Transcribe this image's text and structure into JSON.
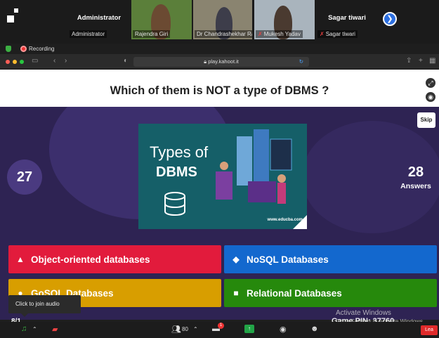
{
  "participants": [
    {
      "name": "Administrator",
      "big_name": "Administrator",
      "muted": false
    },
    {
      "name": "Rajendra Giri",
      "muted": false
    },
    {
      "name": "Dr Chandrashekhar Rag...",
      "muted": false
    },
    {
      "name": "Mukesh Yadav",
      "muted": true
    },
    {
      "name": "Sagar tiwari",
      "big_name": "Sagar tiwari",
      "muted": true
    }
  ],
  "recording": {
    "label": "Recording"
  },
  "browser": {
    "url": "play.kahoot.it"
  },
  "quiz": {
    "question": "Which of them is NOT a type of DBMS ?",
    "skip_label": "Skip",
    "timer": "27",
    "answers_count": "28",
    "answers_label": "Answers",
    "image": {
      "line1": "Types of",
      "line2": "DBMS",
      "url": "www.educba.com"
    },
    "options": [
      {
        "shape": "▲",
        "label": "Object-oriented databases",
        "color": "#e21b3c"
      },
      {
        "shape": "◆",
        "label": "NoSQL Databases",
        "color": "#1368ce"
      },
      {
        "shape": "●",
        "label": "GoSQL Databases",
        "color": "#d89e00"
      },
      {
        "shape": "■",
        "label": "Relational Databases",
        "color": "#26890c"
      }
    ],
    "progress": "8/1",
    "game_pin": "Game PIN: 37760"
  },
  "tooltip": "Click to join audio",
  "watermark": {
    "line1": "Activate Windows",
    "line2": "Go to Settings to activate Windows."
  },
  "toolbar": {
    "participants_count": "80",
    "chat_badge": "1",
    "leave_label": "Lea"
  }
}
